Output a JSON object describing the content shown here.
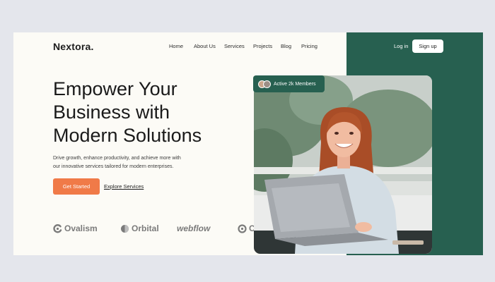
{
  "logo": "Nextora.",
  "nav": {
    "items": [
      "Home",
      "About Us",
      "Services",
      "Projects",
      "Blog",
      "Pricing"
    ],
    "login_label": "Log in",
    "signup_label": "Sign up"
  },
  "hero": {
    "headline_lines": [
      "Empower Your",
      "Business with",
      "Modern Solutions"
    ],
    "description_lines": [
      "Drive growth, enhance productivity, and achieve more with",
      "our innovative services tailored for modern enterprises."
    ],
    "cta_label": "Get Started",
    "secondary_link": "Explore Services"
  },
  "badge": {
    "text": "Active 2k Members"
  },
  "brands": [
    "Ovalism",
    "Orbital",
    "webflow",
    "C"
  ],
  "colors": {
    "accent_green": "#276050",
    "cta_orange": "#f07a48",
    "background": "#fcfbf6",
    "page_bg": "#e4e6ec"
  },
  "icons": [
    "ovalism-logo-icon",
    "orbital-logo-icon",
    "webflow-logo-icon"
  ]
}
